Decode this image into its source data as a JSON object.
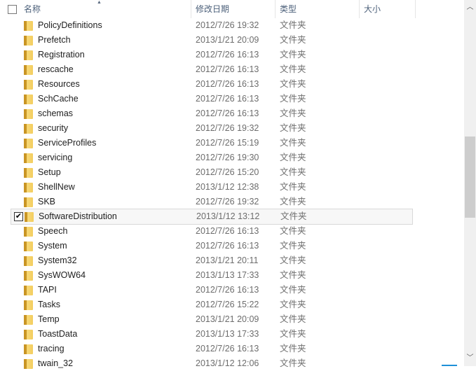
{
  "header": {
    "name": "名称",
    "date": "修改日期",
    "type": "类型",
    "size": "大小"
  },
  "rows": [
    {
      "name": "PolicyDefinitions",
      "date": "2012/7/26 19:32",
      "type": "文件夹"
    },
    {
      "name": "Prefetch",
      "date": "2013/1/21 20:09",
      "type": "文件夹"
    },
    {
      "name": "Registration",
      "date": "2012/7/26 16:13",
      "type": "文件夹"
    },
    {
      "name": "rescache",
      "date": "2012/7/26 16:13",
      "type": "文件夹"
    },
    {
      "name": "Resources",
      "date": "2012/7/26 16:13",
      "type": "文件夹"
    },
    {
      "name": "SchCache",
      "date": "2012/7/26 16:13",
      "type": "文件夹"
    },
    {
      "name": "schemas",
      "date": "2012/7/26 16:13",
      "type": "文件夹"
    },
    {
      "name": "security",
      "date": "2012/7/26 19:32",
      "type": "文件夹"
    },
    {
      "name": "ServiceProfiles",
      "date": "2012/7/26 15:19",
      "type": "文件夹"
    },
    {
      "name": "servicing",
      "date": "2012/7/26 19:30",
      "type": "文件夹"
    },
    {
      "name": "Setup",
      "date": "2012/7/26 15:20",
      "type": "文件夹"
    },
    {
      "name": "ShellNew",
      "date": "2013/1/12 12:38",
      "type": "文件夹"
    },
    {
      "name": "SKB",
      "date": "2012/7/26 19:32",
      "type": "文件夹"
    },
    {
      "name": "SoftwareDistribution",
      "date": "2013/1/12 13:12",
      "type": "文件夹",
      "checked": true
    },
    {
      "name": "Speech",
      "date": "2012/7/26 16:13",
      "type": "文件夹"
    },
    {
      "name": "System",
      "date": "2012/7/26 16:13",
      "type": "文件夹"
    },
    {
      "name": "System32",
      "date": "2013/1/21 20:11",
      "type": "文件夹"
    },
    {
      "name": "SysWOW64",
      "date": "2013/1/13 17:33",
      "type": "文件夹"
    },
    {
      "name": "TAPI",
      "date": "2012/7/26 16:13",
      "type": "文件夹"
    },
    {
      "name": "Tasks",
      "date": "2012/7/26 15:22",
      "type": "文件夹"
    },
    {
      "name": "Temp",
      "date": "2013/1/21 20:09",
      "type": "文件夹"
    },
    {
      "name": "ToastData",
      "date": "2013/1/13 17:33",
      "type": "文件夹"
    },
    {
      "name": "tracing",
      "date": "2012/7/26 16:13",
      "type": "文件夹"
    },
    {
      "name": "twain_32",
      "date": "2013/1/12 12:06",
      "type": "文件夹"
    }
  ],
  "scrollbar": {
    "up_icon": "chevron-up-icon",
    "down_icon": "chevron-down-icon"
  }
}
